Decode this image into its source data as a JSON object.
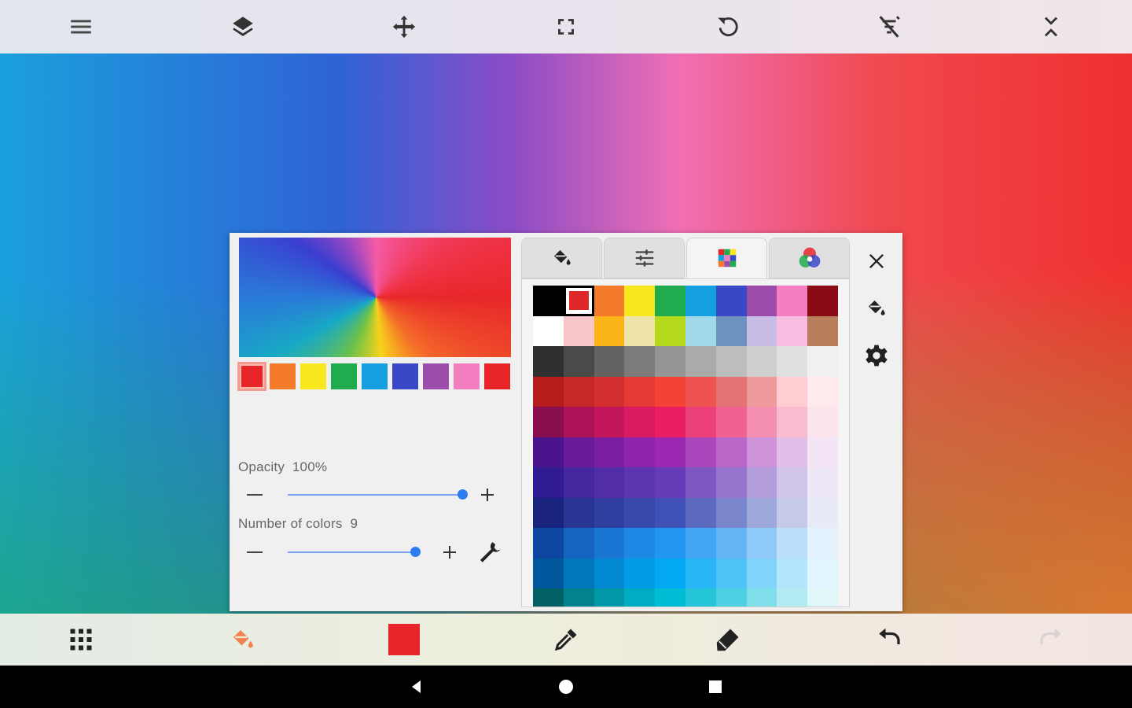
{
  "top_toolbar": {
    "buttons": [
      {
        "name": "menu-icon"
      },
      {
        "name": "layers-icon"
      },
      {
        "name": "move-icon"
      },
      {
        "name": "fullscreen-icon"
      },
      {
        "name": "rotate-icon"
      },
      {
        "name": "no-fill-icon"
      },
      {
        "name": "collapse-icon"
      }
    ]
  },
  "colors": {
    "toolbar_icon": "#444444",
    "paint_bucket_active": "#f2824c",
    "current_color": "#e8262a",
    "slider_accent": "#2e7df0"
  },
  "recent_colors": [
    "#e8262a",
    "#f47b2a",
    "#f8e71c",
    "#1fab4e",
    "#14a0e0",
    "#3a48c8",
    "#9c4cab",
    "#f47fc0",
    "#e8262a"
  ],
  "opacity": {
    "label": "Opacity",
    "value": "100%",
    "fraction": 1.0
  },
  "number_of_colors": {
    "label": "Number of colors",
    "value": "9",
    "fraction": 0.73
  },
  "tabs": [
    {
      "name": "tab-fill",
      "icon": "paint-bucket-icon"
    },
    {
      "name": "tab-adjust",
      "icon": "sliders-icon"
    },
    {
      "name": "tab-palette",
      "icon": "palette-grid-icon",
      "active": true
    },
    {
      "name": "tab-color-wheel",
      "icon": "color-wheel-icon"
    }
  ],
  "palette_rows": [
    [
      "#000000",
      "#e8262a",
      "#f47b2a",
      "#f8e71c",
      "#1fab4e",
      "#14a0e0",
      "#3a48c8",
      "#9c4cab",
      "#f47fc0",
      "#8a0b16"
    ],
    [
      "#ffffff",
      "#f8c6c8",
      "#fbb51a",
      "#efe3a8",
      "#b5d91c",
      "#9fd9ea",
      "#6d92c0",
      "#c9bce6",
      "#f8bde0",
      "#b87d5a"
    ],
    [
      "#303030",
      "#4a4a4a",
      "#636363",
      "#7c7c7c",
      "#959595",
      "#aaaaaa",
      "#bdbdbd",
      "#cfcfcf",
      "#e0e0e0",
      "#f0f0f0"
    ],
    [
      "#b71c1c",
      "#c62828",
      "#d32f2f",
      "#e53935",
      "#f44336",
      "#ef5350",
      "#e57373",
      "#ef9a9a",
      "#ffcdd2",
      "#ffebee"
    ],
    [
      "#880e4f",
      "#ad1457",
      "#c2185b",
      "#d81b60",
      "#e91e63",
      "#ec407a",
      "#f06292",
      "#f48fb1",
      "#f8bbd0",
      "#fce4ec"
    ],
    [
      "#4a148c",
      "#6a1b9a",
      "#7b1fa2",
      "#8e24aa",
      "#9c27b0",
      "#ab47bc",
      "#ba68c8",
      "#ce93d8",
      "#e1bee7",
      "#f3e5f5"
    ],
    [
      "#311b92",
      "#4527a0",
      "#512da8",
      "#5e35b1",
      "#673ab7",
      "#7e57c2",
      "#9575cd",
      "#b39ddb",
      "#d1c4e9",
      "#ede7f6"
    ],
    [
      "#1a237e",
      "#283593",
      "#303f9f",
      "#3949ab",
      "#3f51b5",
      "#5c6bc0",
      "#7986cb",
      "#9fa8da",
      "#c5cae9",
      "#e8eaf6"
    ],
    [
      "#0d47a1",
      "#1565c0",
      "#1976d2",
      "#1e88e5",
      "#2196f3",
      "#42a5f5",
      "#64b5f6",
      "#90caf9",
      "#bbdefb",
      "#e3f2fd"
    ],
    [
      "#01579b",
      "#0277bd",
      "#0288d1",
      "#039be5",
      "#03a9f4",
      "#29b6f6",
      "#4fc3f7",
      "#81d4fa",
      "#b3e5fc",
      "#e1f5fe"
    ],
    [
      "#006064",
      "#00838f",
      "#0097a7",
      "#00acc1",
      "#00bcd4",
      "#26c6da",
      "#4dd0e1",
      "#80deea",
      "#b2ebf2",
      "#e0f7fa"
    ]
  ],
  "side_tools": [
    {
      "name": "close-icon"
    },
    {
      "name": "paint-bucket-icon"
    },
    {
      "name": "settings-gear-icon"
    }
  ],
  "bottom_toolbar": [
    {
      "name": "apps-grid-icon"
    },
    {
      "name": "paint-bucket-icon"
    },
    {
      "name": "current-color-swatch"
    },
    {
      "name": "eyedropper-icon"
    },
    {
      "name": "eraser-icon"
    },
    {
      "name": "undo-icon"
    },
    {
      "name": "redo-icon",
      "disabled": true
    }
  ],
  "nav_bar": [
    {
      "name": "back-icon"
    },
    {
      "name": "home-icon"
    },
    {
      "name": "recents-icon"
    }
  ]
}
